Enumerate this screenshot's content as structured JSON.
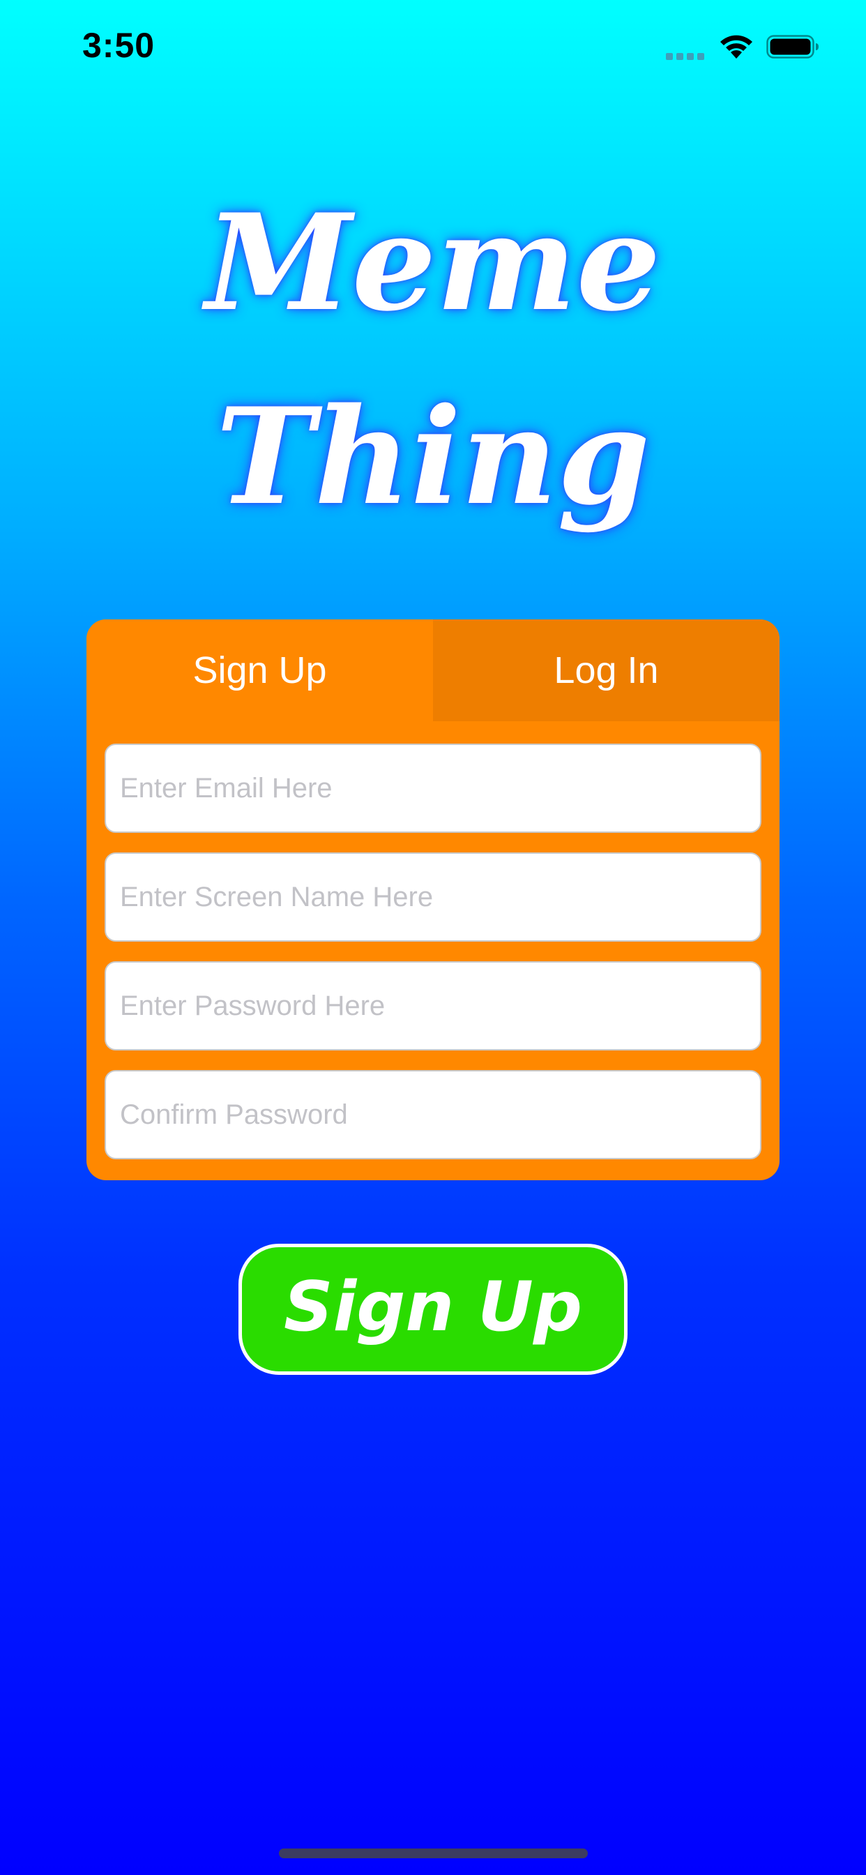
{
  "status_bar": {
    "time": "3:50",
    "icons": [
      "cellular-signal-icon",
      "wifi-icon",
      "battery-icon"
    ]
  },
  "app": {
    "title_line1": "Meme",
    "title_line2": "Thing"
  },
  "auth_card": {
    "tabs": [
      {
        "label": "Sign Up",
        "selected": true
      },
      {
        "label": "Log In",
        "selected": false
      }
    ],
    "fields": {
      "email": {
        "value": "",
        "placeholder": "Enter Email Here"
      },
      "screen_name": {
        "value": "",
        "placeholder": "Enter Screen Name Here"
      },
      "password": {
        "value": "",
        "placeholder": "Enter Password Here"
      },
      "confirm_password": {
        "value": "",
        "placeholder": "Confirm Password"
      }
    }
  },
  "primary_action": {
    "label": "Sign Up"
  },
  "colors": {
    "background_top": "#00FFFF",
    "background_bottom": "#0000FF",
    "card": "#FF8800",
    "inactive_tab": "#EE7E00",
    "button": "#2ADC00",
    "title_glow": "#2838FF"
  }
}
